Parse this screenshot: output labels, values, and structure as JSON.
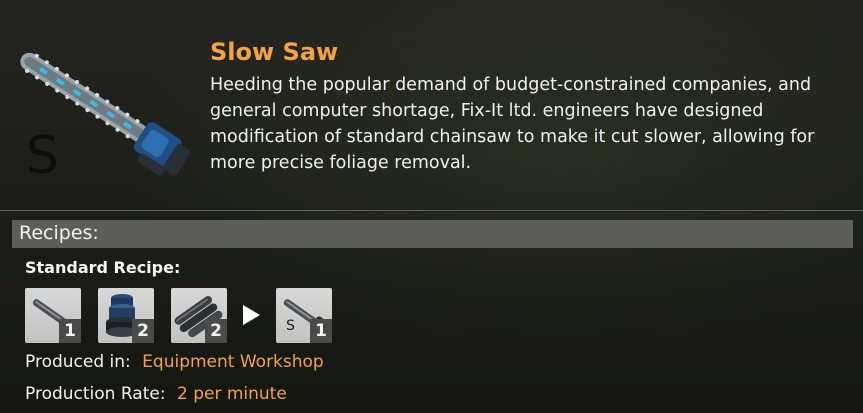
{
  "item": {
    "title": "Slow Saw",
    "description": "Heeding the popular demand of budget-constrained companies, and general computer shortage, Fix-It ltd. engineers have designed modification of standard chainsaw to make it cut slower, allowing for more precise foliage removal.",
    "icon_letter": "S",
    "icon_name": "chainsaw-icon"
  },
  "recipes": {
    "header": "Recipes:",
    "recipe_name": "Standard Recipe:",
    "inputs": [
      {
        "icon": "rod-icon",
        "count": "1"
      },
      {
        "icon": "gear-stack-icon",
        "count": "2"
      },
      {
        "icon": "pipes-icon",
        "count": "2"
      }
    ],
    "output": {
      "icon": "chainsaw-icon",
      "letter": "S",
      "count": "1"
    },
    "produced_in_label": "Produced in:",
    "produced_in_value": "Equipment Workshop",
    "rate_label": "Production Rate:",
    "rate_value": "2 per minute"
  },
  "colors": {
    "accent": "#f2a347",
    "bar": "#5d5d5c",
    "slot": "#cfcfcf",
    "count_bg": "#4a4a4a"
  }
}
